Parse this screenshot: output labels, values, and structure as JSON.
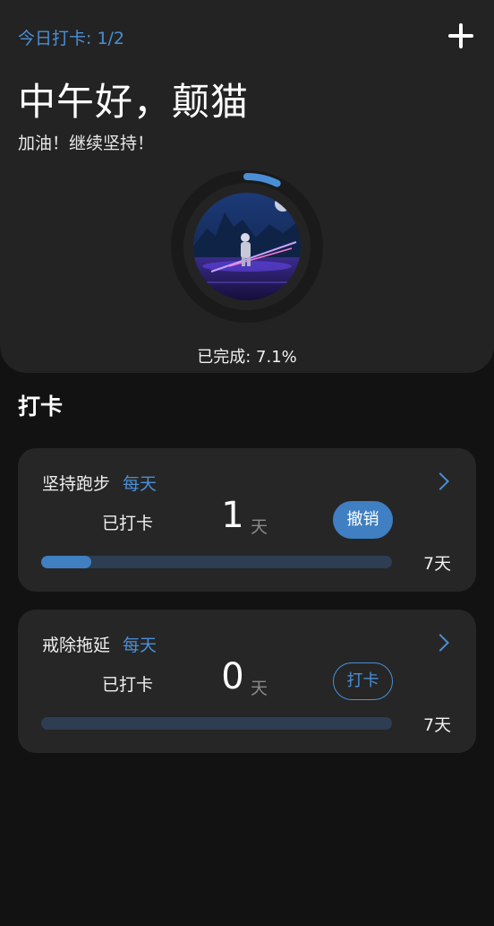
{
  "header": {
    "today_label": "今日打卡: 1/2",
    "greeting": "中午好，颠猫",
    "motto": "加油！继续坚持！",
    "progress_fraction": 0.071,
    "complete_text": "已完成: 7.1%",
    "add_icon": "plus-icon"
  },
  "section": {
    "title": "打卡"
  },
  "habits": [
    {
      "name": "坚持跑步",
      "frequency": "每天",
      "done_label": "已打卡",
      "count": "1",
      "unit": "天",
      "action": "撤销",
      "action_style": "filled",
      "goal": "7天",
      "progress_fraction": 0.143
    },
    {
      "name": "戒除拖延",
      "frequency": "每天",
      "done_label": "已打卡",
      "count": "0",
      "unit": "天",
      "action": "打卡",
      "action_style": "outline",
      "goal": "7天",
      "progress_fraction": 0
    }
  ],
  "colors": {
    "accent": "#4a8fd6",
    "button_fill": "#3f7fc2",
    "track": "#2d3d52",
    "background": "#121212",
    "card": "#262626"
  }
}
